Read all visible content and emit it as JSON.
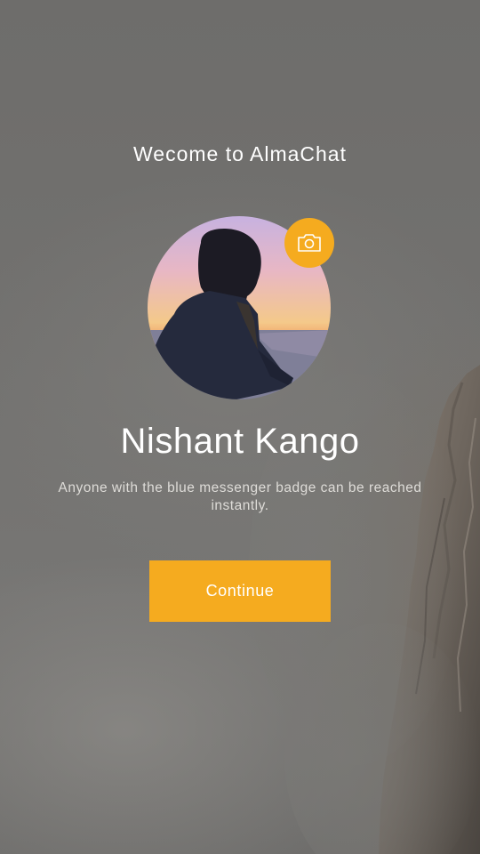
{
  "screen": {
    "welcome_title": "Wecome to AlmaChat",
    "profile_name": "Nishant Kango",
    "description": "Anyone with the blue messenger badge can be reached instantly.",
    "continue_label": "Continue"
  },
  "icons": {
    "camera": "camera-icon"
  },
  "colors": {
    "accent": "#f5ab1f",
    "text_primary": "#ffffff",
    "text_secondary": "#dedcd8",
    "background": "#6d6c6a"
  }
}
